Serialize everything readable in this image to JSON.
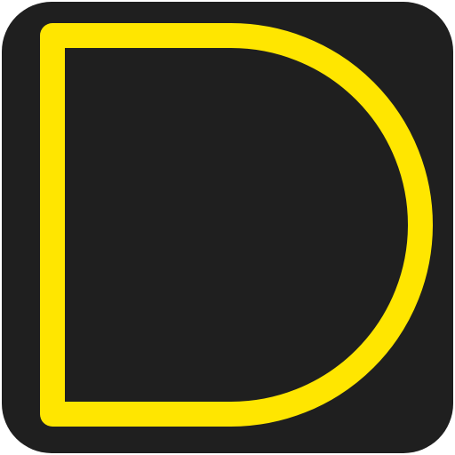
{
  "app_icon": {
    "icon_name": "letter-d-logo-icon",
    "background_color": "#1f1f1f",
    "stroke_color": "#ffe600"
  }
}
